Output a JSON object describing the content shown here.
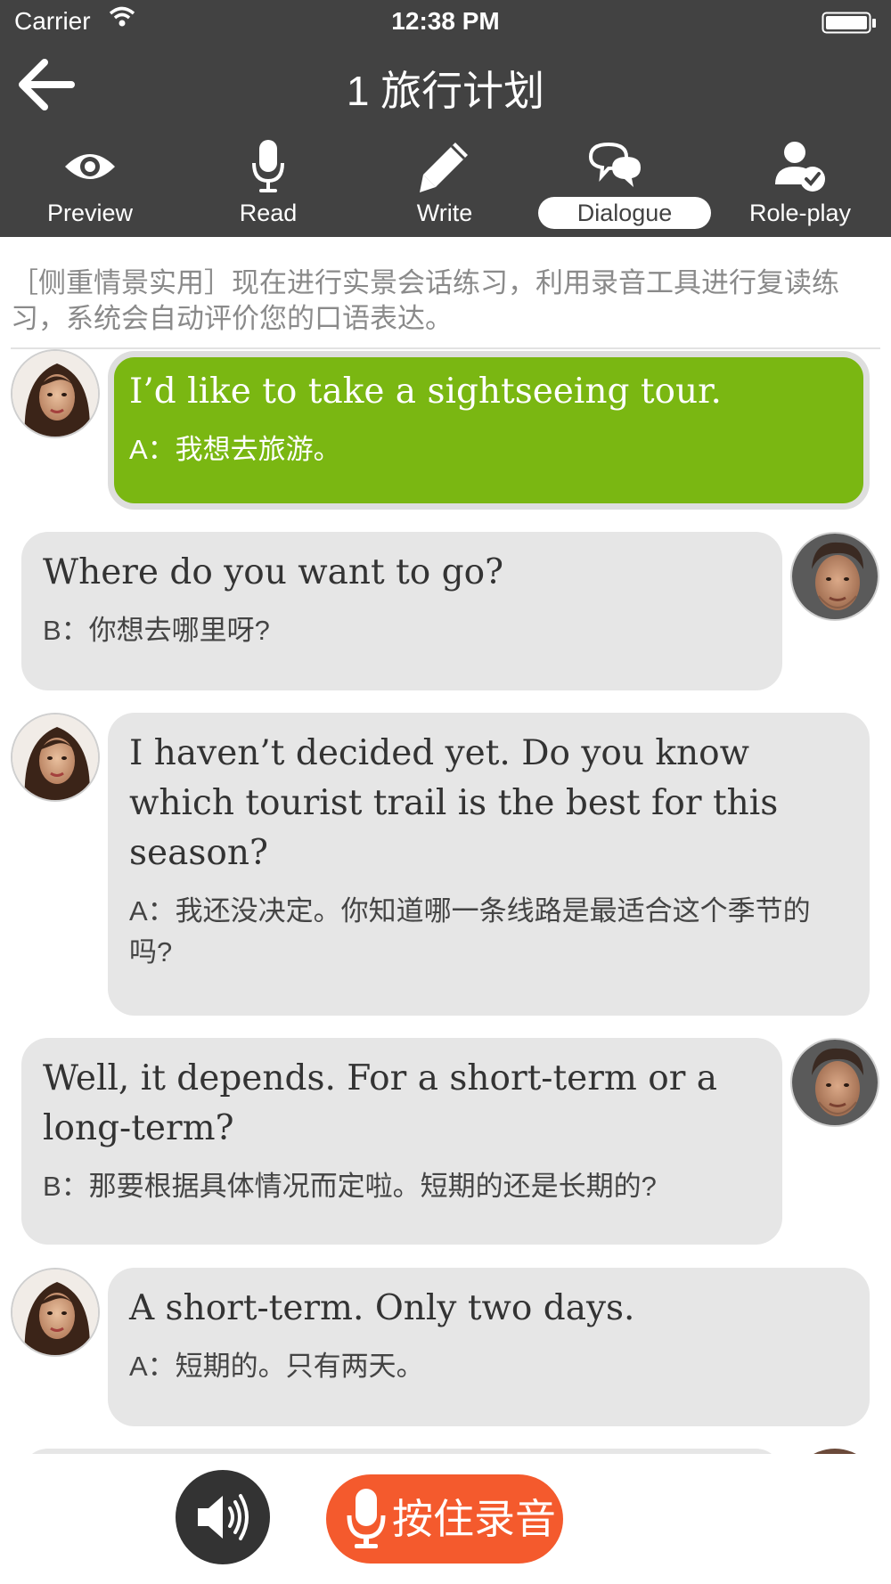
{
  "status_bar": {
    "carrier": "Carrier",
    "time": "12:38 PM"
  },
  "nav": {
    "title": "1 旅行计划",
    "back_icon": "arrow-left-icon"
  },
  "tabs": [
    {
      "label": "Preview",
      "icon": "eye-icon",
      "active": false
    },
    {
      "label": "Read",
      "icon": "microphone-icon",
      "active": false
    },
    {
      "label": "Write",
      "icon": "pencil-icon",
      "active": false
    },
    {
      "label": "Dialogue",
      "icon": "chat-bubbles-icon",
      "active": true
    },
    {
      "label": "Role-play",
      "icon": "user-check-icon",
      "active": false
    }
  ],
  "instruction": "［侧重情景实用］现在进行实景会话练习，利用录音工具进行复读练习，系统会自动评价您的口语表达。",
  "dialogue": [
    {
      "speaker": "A",
      "en": "I’d like to take a sightseeing tour.",
      "zh": "A：我想去旅游。",
      "highlighted": true
    },
    {
      "speaker": "B",
      "en": "Where do you want to go?",
      "zh": "B：你想去哪里呀?"
    },
    {
      "speaker": "A",
      "en": "I haven’t decided yet. Do you know which tourist trail is the best for this season?",
      "zh": "A：我还没决定。你知道哪一条线路是最适合这个季节的吗?"
    },
    {
      "speaker": "B",
      "en": "Well, it depends. For a short-term or a long-term?",
      "zh": "B：那要根据具体情况而定啦。短期的还是长期的?"
    },
    {
      "speaker": "A",
      "en": "A short-term. Only two days.",
      "zh": "A：短期的。只有两天。"
    }
  ],
  "controls": {
    "speaker_icon": "speaker-icon",
    "record_label": "按住录音",
    "record_icon": "microphone-icon"
  },
  "colors": {
    "header_bg": "#424242",
    "highlight_bubble": "#7ab712",
    "bubble_bg": "#e6e6e6",
    "record_button": "#f45a2d"
  }
}
